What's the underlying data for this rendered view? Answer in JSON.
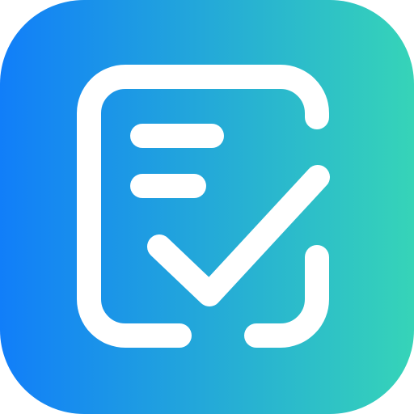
{
  "icon": {
    "name": "checklist-document-app-icon",
    "glyph": "document-with-checkmark",
    "gradient": {
      "start": "#117EF9",
      "end": "#36D4B8"
    },
    "glyph_color": "#FFFFFF"
  }
}
